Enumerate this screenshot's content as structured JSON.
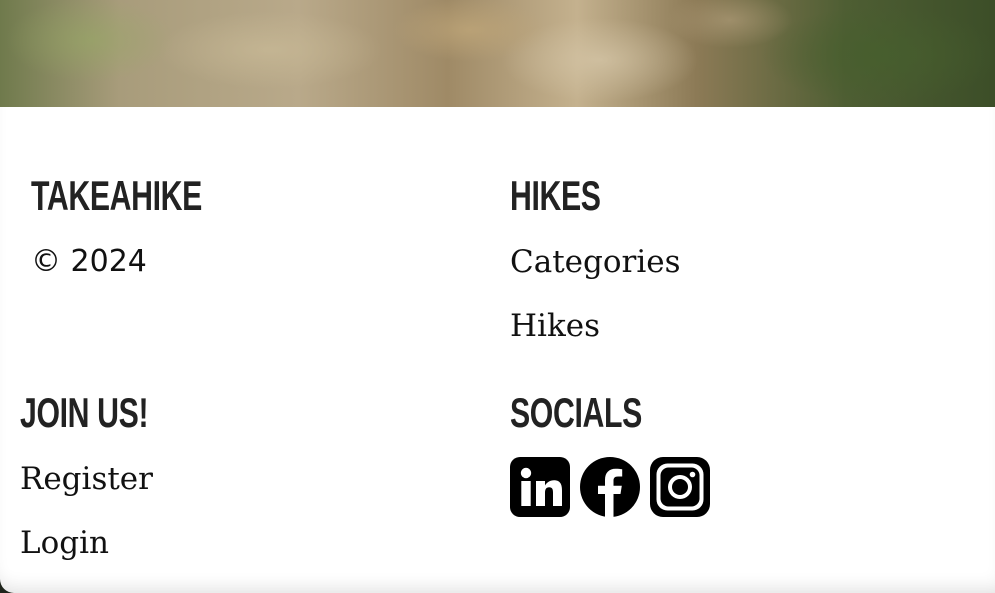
{
  "footer": {
    "brand": {
      "heading": "TAKEAHIKE",
      "copyright": "© 2024"
    },
    "hikes": {
      "heading": "HIKES",
      "links": [
        "Categories",
        "Hikes"
      ]
    },
    "join": {
      "heading": "JOIN US!",
      "links": [
        "Register",
        "Login"
      ]
    },
    "socials": {
      "heading": "SOCIALS",
      "icons": [
        "linkedin-icon",
        "facebook-icon",
        "instagram-icon"
      ]
    }
  }
}
